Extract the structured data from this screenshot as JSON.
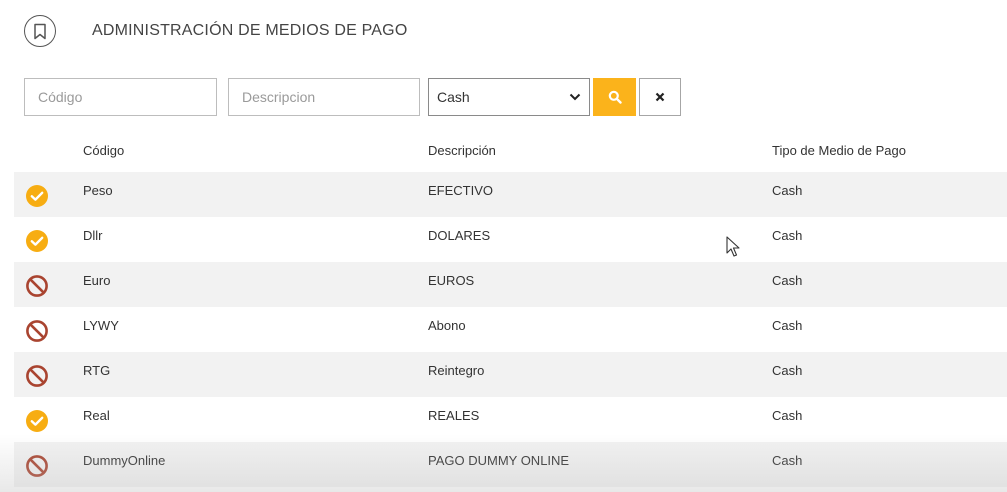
{
  "header": {
    "title": "ADMINISTRACIÓN DE MEDIOS DE PAGO",
    "icon": "bookmark-icon"
  },
  "filters": {
    "codigo_placeholder": "Código",
    "descripcion_placeholder": "Descripcion",
    "tipo_selected": "Cash",
    "search_icon": "search-icon",
    "clear_icon": "close-icon"
  },
  "table": {
    "columns": [
      "Código",
      "Descripción",
      "Tipo de Medio de Pago"
    ],
    "rows": [
      {
        "status": "active",
        "codigo": "Peso",
        "descripcion": "EFECTIVO",
        "tipo": "Cash"
      },
      {
        "status": "active",
        "codigo": "Dllr",
        "descripcion": "DOLARES",
        "tipo": "Cash"
      },
      {
        "status": "inactive",
        "codigo": "Euro",
        "descripcion": "EUROS",
        "tipo": "Cash"
      },
      {
        "status": "inactive",
        "codigo": "LYWY",
        "descripcion": "Abono",
        "tipo": "Cash"
      },
      {
        "status": "inactive",
        "codigo": "RTG",
        "descripcion": "Reintegro",
        "tipo": "Cash"
      },
      {
        "status": "active",
        "codigo": "Real",
        "descripcion": "REALES",
        "tipo": "Cash"
      },
      {
        "status": "inactive",
        "codigo": "DummyOnline",
        "descripcion": "PAGO DUMMY ONLINE",
        "tipo": "Cash"
      }
    ]
  },
  "colors": {
    "accent": "#fbb31b",
    "active": "#f7ad12",
    "inactive": "#a94430",
    "row_alt": "#f2f2f2"
  }
}
